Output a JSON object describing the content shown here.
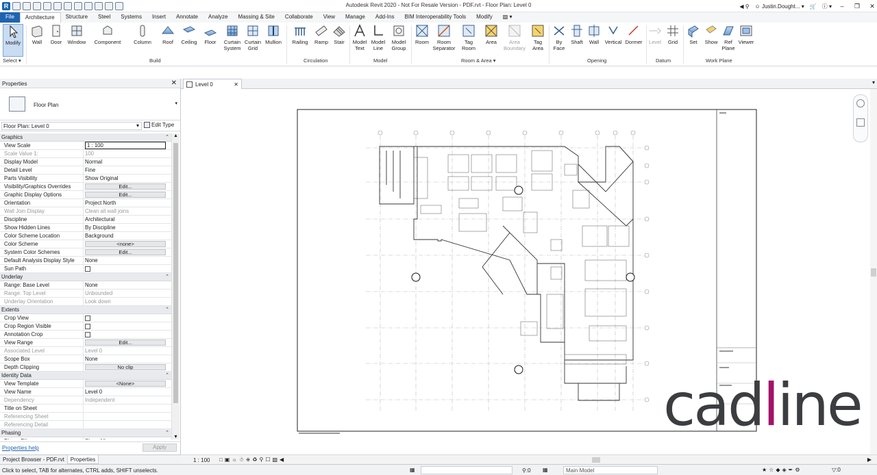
{
  "window": {
    "title": "Autodesk Revit 2020 - Not For Resale Version - PDF.rvt - Floor Plan: Level 0",
    "user": "Justin.Dought..."
  },
  "tabs": [
    "File",
    "Architecture",
    "Structure",
    "Steel",
    "Systems",
    "Insert",
    "Annotate",
    "Analyze",
    "Massing & Site",
    "Collaborate",
    "View",
    "Manage",
    "Add-Ins",
    "BIM Interoperability Tools",
    "Modify"
  ],
  "active_tab": "Architecture",
  "ribbon": {
    "tools": {
      "modify": "Modify",
      "wall": "Wall",
      "door": "Door",
      "window": "Window",
      "component": "Component",
      "column": "Column",
      "roof": "Roof",
      "ceiling": "Ceiling",
      "floor": "Floor",
      "curtain_system_1": "Curtain",
      "curtain_system_2": "System",
      "curtain_grid_1": "Curtain",
      "curtain_grid_2": "Grid",
      "mullion": "Mullion",
      "railing": "Railing",
      "ramp": "Ramp",
      "stair": "Stair",
      "model_text_1": "Model",
      "model_text_2": "Text",
      "model_line_1": "Model",
      "model_line_2": "Line",
      "model_group_1": "Model",
      "model_group_2": "Group",
      "room": "Room",
      "room_sep_1": "Room",
      "room_sep_2": "Separator",
      "tag_room_1": "Tag",
      "tag_room_2": "Room",
      "area": "Area",
      "area_boundary_1": "Area",
      "area_boundary_2": "Boundary",
      "tag_area_1": "Tag",
      "tag_area_2": "Area",
      "by_face_1": "By",
      "by_face_2": "Face",
      "shaft": "Shaft",
      "open_wall": "Wall",
      "vertical": "Vertical",
      "dormer": "Dormer",
      "level": "Level",
      "grid": "Grid",
      "set": "Set",
      "show": "Show",
      "ref_plane_1": "Ref",
      "ref_plane_2": "Plane",
      "viewer": "Viewer"
    },
    "groups": {
      "select": "Select",
      "build": "Build",
      "circulation": "Circulation",
      "model": "Model",
      "room_area": "Room & Area",
      "opening": "Opening",
      "datum": "Datum",
      "work_plane": "Work Plane"
    }
  },
  "properties": {
    "title": "Properties",
    "type_name": "Floor Plan",
    "instance": "Floor Plan: Level 0",
    "edit_type": "Edit Type",
    "sections": {
      "graphics": "Graphics",
      "underlay": "Underlay",
      "extents": "Extents",
      "identity": "Identity Data",
      "phasing": "Phasing"
    },
    "graphics_rows": [
      {
        "k": "View Scale",
        "v": "1 : 100",
        "kind": "boxed"
      },
      {
        "k": "Scale Value    1:",
        "v": "100",
        "kind": "grey"
      },
      {
        "k": "Display Model",
        "v": "Normal"
      },
      {
        "k": "Detail Level",
        "v": "Fine"
      },
      {
        "k": "Parts Visibility",
        "v": "Show Original"
      },
      {
        "k": "Visibility/Graphics Overrides",
        "v": "Edit...",
        "kind": "btn"
      },
      {
        "k": "Graphic Display Options",
        "v": "Edit...",
        "kind": "btn"
      },
      {
        "k": "Orientation",
        "v": "Project North"
      },
      {
        "k": "Wall Join Display",
        "v": "Clean all wall joins",
        "kind": "grey"
      },
      {
        "k": "Discipline",
        "v": "Architectural"
      },
      {
        "k": "Show Hidden Lines",
        "v": "By Discipline"
      },
      {
        "k": "Color Scheme Location",
        "v": "Background"
      },
      {
        "k": "Color Scheme",
        "v": "<none>",
        "kind": "btn"
      },
      {
        "k": "System Color Schemes",
        "v": "Edit...",
        "kind": "btn"
      },
      {
        "k": "Default Analysis Display Style",
        "v": "None"
      },
      {
        "k": "Sun Path",
        "v": "",
        "kind": "cb"
      }
    ],
    "underlay_rows": [
      {
        "k": "Range: Base Level",
        "v": "None"
      },
      {
        "k": "Range: Top Level",
        "v": "Unbounded",
        "kind": "grey"
      },
      {
        "k": "Underlay Orientation",
        "v": "Look down",
        "kind": "grey"
      }
    ],
    "extents_rows": [
      {
        "k": "Crop View",
        "v": "",
        "kind": "cb"
      },
      {
        "k": "Crop Region Visible",
        "v": "",
        "kind": "cb"
      },
      {
        "k": "Annotation Crop",
        "v": "",
        "kind": "cb"
      },
      {
        "k": "View Range",
        "v": "Edit...",
        "kind": "btn"
      },
      {
        "k": "Associated Level",
        "v": "Level 0",
        "kind": "grey"
      },
      {
        "k": "Scope Box",
        "v": "None"
      },
      {
        "k": "Depth Clipping",
        "v": "No clip",
        "kind": "btn"
      }
    ],
    "identity_rows": [
      {
        "k": "View Template",
        "v": "<None>",
        "kind": "btn"
      },
      {
        "k": "View Name",
        "v": "Level 0"
      },
      {
        "k": "Dependency",
        "v": "Independent",
        "kind": "grey"
      },
      {
        "k": "Title on Sheet",
        "v": ""
      },
      {
        "k": "Referencing Sheet",
        "v": "",
        "kind": "grey"
      },
      {
        "k": "Referencing Detail",
        "v": "",
        "kind": "grey"
      }
    ],
    "phasing_rows": [
      {
        "k": "Phase Filter",
        "v": "Show All"
      }
    ],
    "help_link": "Properties help",
    "apply": "Apply"
  },
  "browser_tabs": [
    "Project Browser - PDF.rvt",
    "Properties"
  ],
  "view_tab": "Level 0",
  "view_scale": "1 : 100",
  "status": {
    "message": "Click to select, TAB for alternates, CTRL adds, SHIFT unselects.",
    "workset_count": ":0",
    "model": "Main Model",
    "filter_count": ":0"
  },
  "watermark": "cadline",
  "colors": {
    "accent": "#1f64b0",
    "logo_grey": "#3c3d40",
    "logo_magenta": "#a4126a"
  }
}
